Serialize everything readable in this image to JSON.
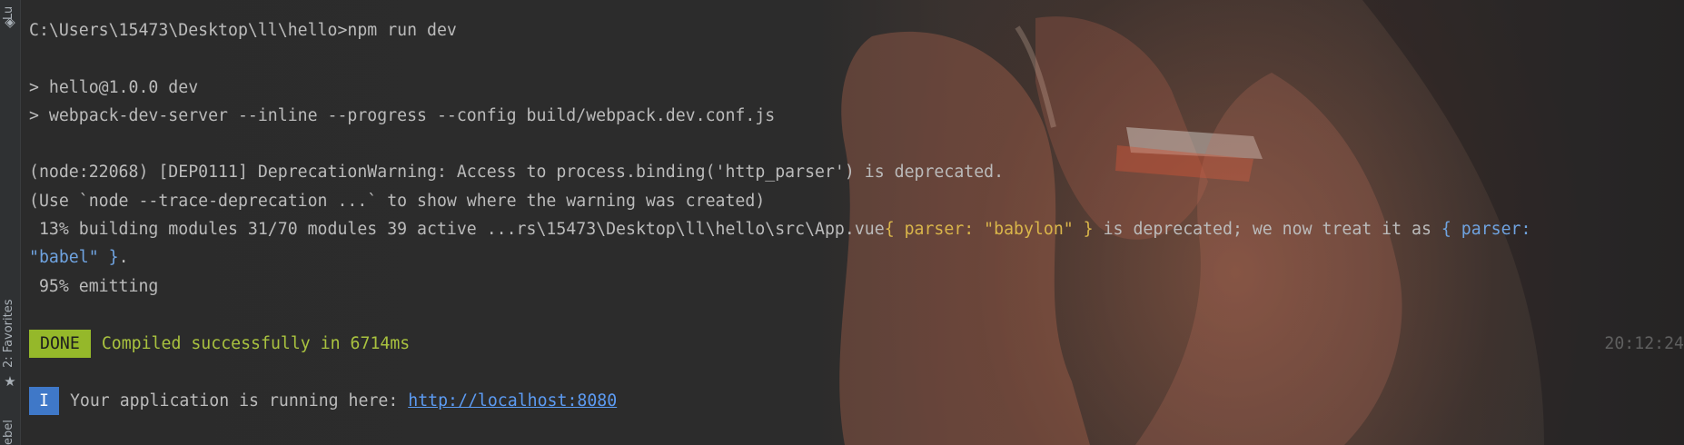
{
  "sidebar": {
    "top_tab": "Lu",
    "favorites_tab": "2: Favorites",
    "bottom_tab": "ebel",
    "icons": {
      "top": "layers-icon",
      "star": "star-icon"
    }
  },
  "terminal": {
    "prompt_line": "C:\\Users\\15473\\Desktop\\ll\\hello>npm run dev",
    "script_name_line": "> hello@1.0.0 dev",
    "script_cmd_line": "> webpack-dev-server --inline --progress --config build/webpack.dev.conf.js",
    "deprecation_line": "(node:22068) [DEP0111] DeprecationWarning: Access to process.binding('http_parser') is deprecated.",
    "trace_hint_line": "(Use `node --trace-deprecation ...` to show where the warning was created)",
    "building": {
      "prefix": " 13% building modules 31/70 modules 39 active ...rs\\15473\\Desktop\\ll\\hello\\src\\App.vue",
      "old_parser": "{ parser: \"babylon\" }",
      "middle": " is deprecated; we now treat it as ",
      "new_parser_part1": "{ parser:",
      "new_parser_part2": "\"babel\" }",
      "suffix": "."
    },
    "emitting_line": " 95% emitting",
    "done": {
      "badge": "DONE",
      "message": "Compiled successfully in 6714ms",
      "time": "20:12:24"
    },
    "info": {
      "badge": "I",
      "message": "Your application is running here: ",
      "url": "http://localhost:8080"
    }
  },
  "colors": {
    "text": "#bbbbbb",
    "yellow": "#d9b54a",
    "blue": "#6fa3e0",
    "done_badge": "#95b82a",
    "info_badge": "#3f78c8",
    "link": "#5c9bf2"
  }
}
